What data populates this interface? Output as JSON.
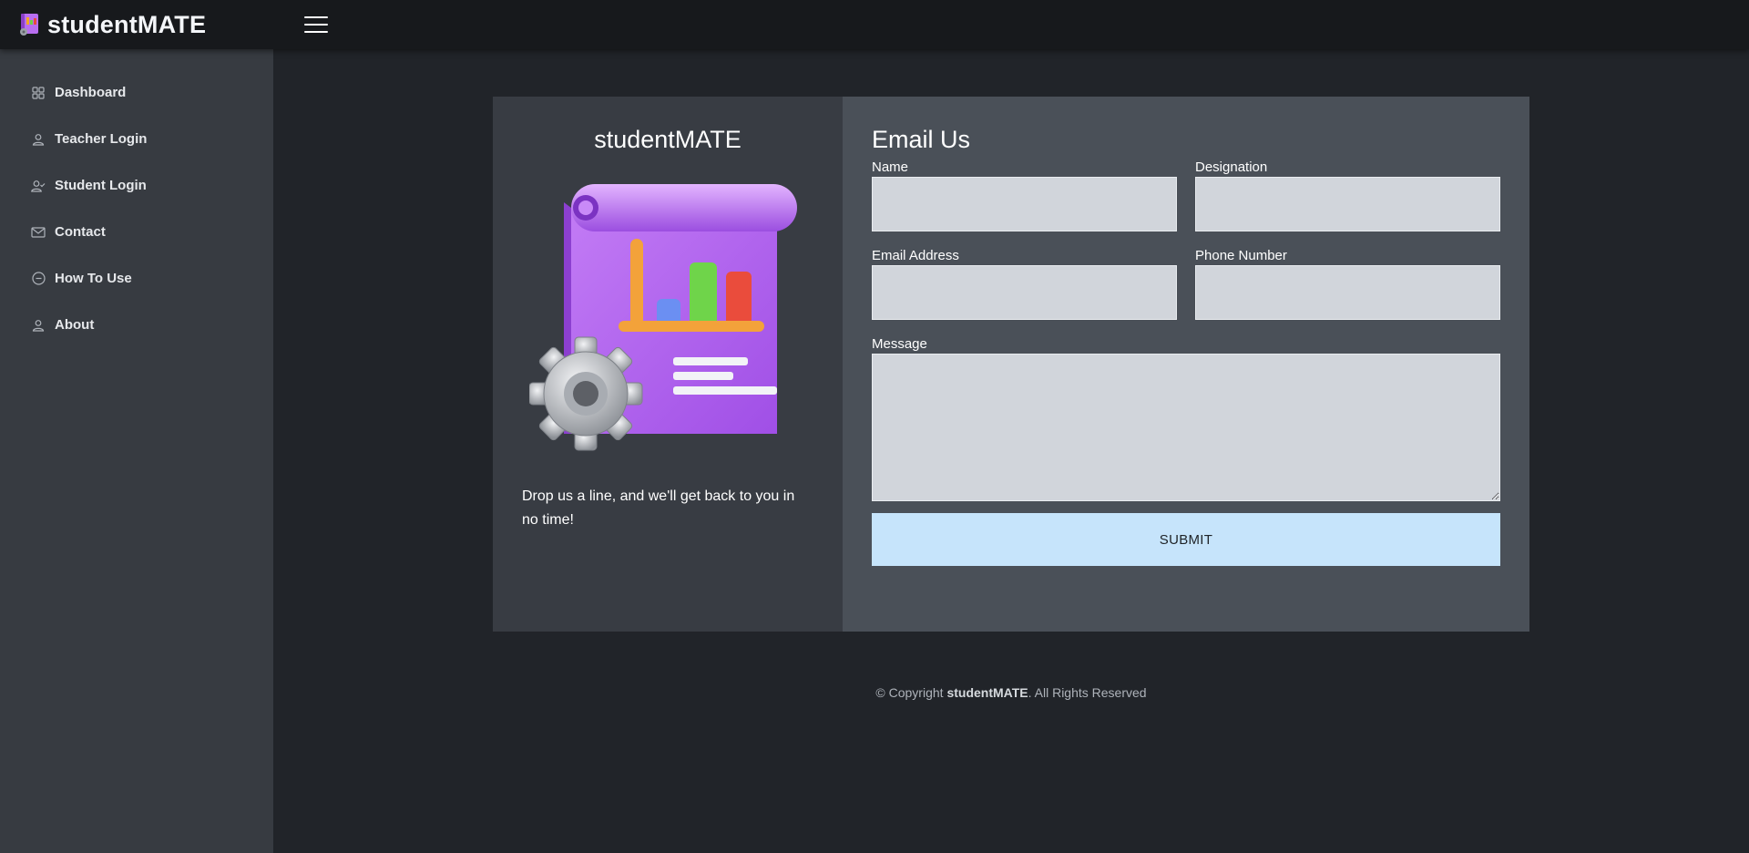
{
  "brand": {
    "name": "studentMATE",
    "logo_icon": "book-icon"
  },
  "header": {
    "menu_icon": "hamburger-icon"
  },
  "sidebar": {
    "items": [
      {
        "label": "Dashboard",
        "icon": "grid-icon"
      },
      {
        "label": "Teacher Login",
        "icon": "person-icon"
      },
      {
        "label": "Student Login",
        "icon": "person-check-icon"
      },
      {
        "label": "Contact",
        "icon": "envelope-icon"
      },
      {
        "label": "How To Use",
        "icon": "dash-circle-icon"
      },
      {
        "label": "About",
        "icon": "person-icon"
      }
    ]
  },
  "contact_card": {
    "left": {
      "title": "studentMATE",
      "tagline": "Drop us a line, and we'll get back to you in no time!"
    },
    "form": {
      "title": "Email Us",
      "name_label": "Name",
      "name_value": "",
      "designation_label": "Designation",
      "designation_value": "",
      "email_label": "Email Address",
      "email_value": "",
      "phone_label": "Phone Number",
      "phone_value": "",
      "message_label": "Message",
      "message_value": "",
      "submit_label": "SUBMIT"
    }
  },
  "footer": {
    "prefix": "© Copyright",
    "brand": "studentMATE",
    "suffix": ". All Rights Reserved"
  },
  "colors": {
    "page_bg": "#212429",
    "topbar_bg": "#17191c",
    "sidebar_bg": "#373b41",
    "card_left_bg": "#383c43",
    "card_right_bg": "#4a5058",
    "input_bg": "#d1d5db",
    "submit_bg": "#c6e4fb"
  }
}
